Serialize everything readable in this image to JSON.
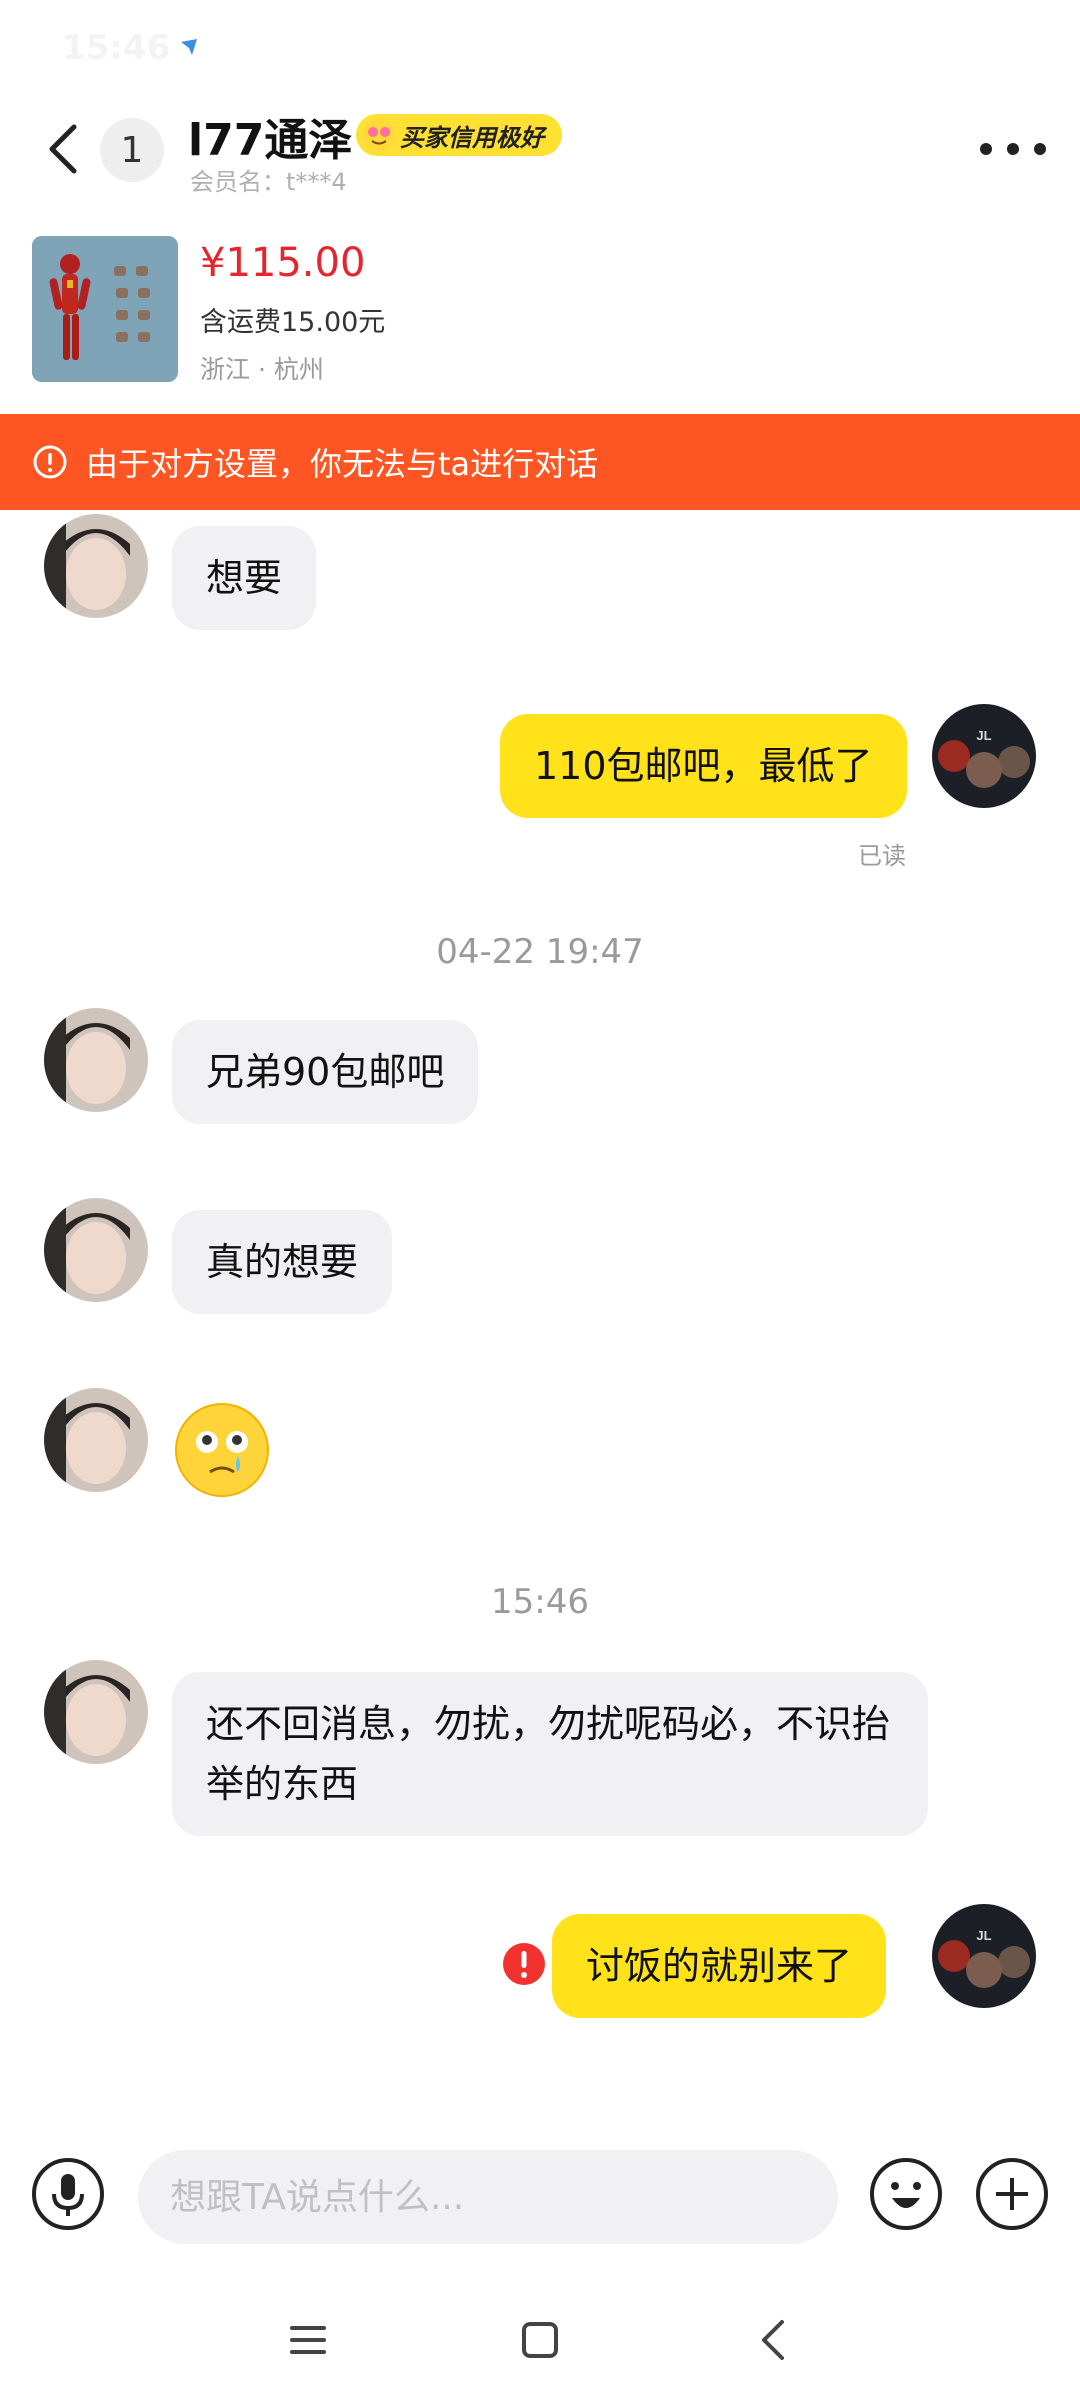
{
  "status_bar": {
    "time": "15:46"
  },
  "header": {
    "unread_count": "1",
    "contact_name": "l77通泽",
    "credit_badge": "买家信用极好",
    "member_name": "会员名：t***4"
  },
  "product": {
    "price": "¥115.00",
    "shipping": "含运费15.00元",
    "location": "浙江 · 杭州"
  },
  "warning": {
    "text": "由于对方设置，你无法与ta进行对话"
  },
  "messages": {
    "m1": "想要",
    "m2": "110包邮吧，最低了",
    "m2_status": "已读",
    "t1": "04-22 19:47",
    "m3": "兄弟90包邮吧",
    "m4": "真的想要",
    "m5_emoji": "crying-face-emoji",
    "t2": "15:46",
    "m6": "还不回消息，勿扰，勿扰呢码必，不识抬举的东西",
    "m7": "讨饭的就别来了"
  },
  "input": {
    "placeholder": "想跟TA说点什么..."
  },
  "icons": {
    "back": "back-arrow-icon",
    "more": "more-dots-icon",
    "warning": "info-circle-icon",
    "error": "error-icon",
    "voice": "microphone-icon",
    "emoji": "emoji-icon",
    "plus": "plus-icon"
  },
  "colors": {
    "accent_yellow": "#ffe21a",
    "banner_orange": "#ff5522",
    "price_red": "#e6252e",
    "bubble_gray": "#f1f1f3"
  }
}
